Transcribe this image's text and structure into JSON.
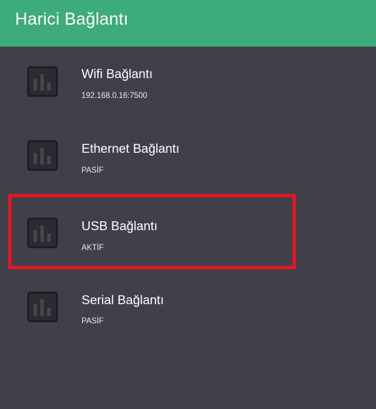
{
  "header": {
    "title": "Harici Bağlantı",
    "background_color": "#3dab7c"
  },
  "list": {
    "background_color": "#40404a",
    "items": [
      {
        "title": "Wifi Bağlantı",
        "subtitle": "192.168.0.16:7500",
        "icon": "bar-chart-icon"
      },
      {
        "title": "Ethernet Bağlantı",
        "subtitle": "PASİF",
        "icon": "bar-chart-icon"
      },
      {
        "title": "USB Bağlantı",
        "subtitle": "AKTİF",
        "icon": "bar-chart-icon"
      },
      {
        "title": "Serial Bağlantı",
        "subtitle": "PASİF",
        "icon": "bar-chart-icon"
      }
    ]
  },
  "highlight": {
    "target": "USB Bağlantı",
    "color": "#e3171e"
  }
}
